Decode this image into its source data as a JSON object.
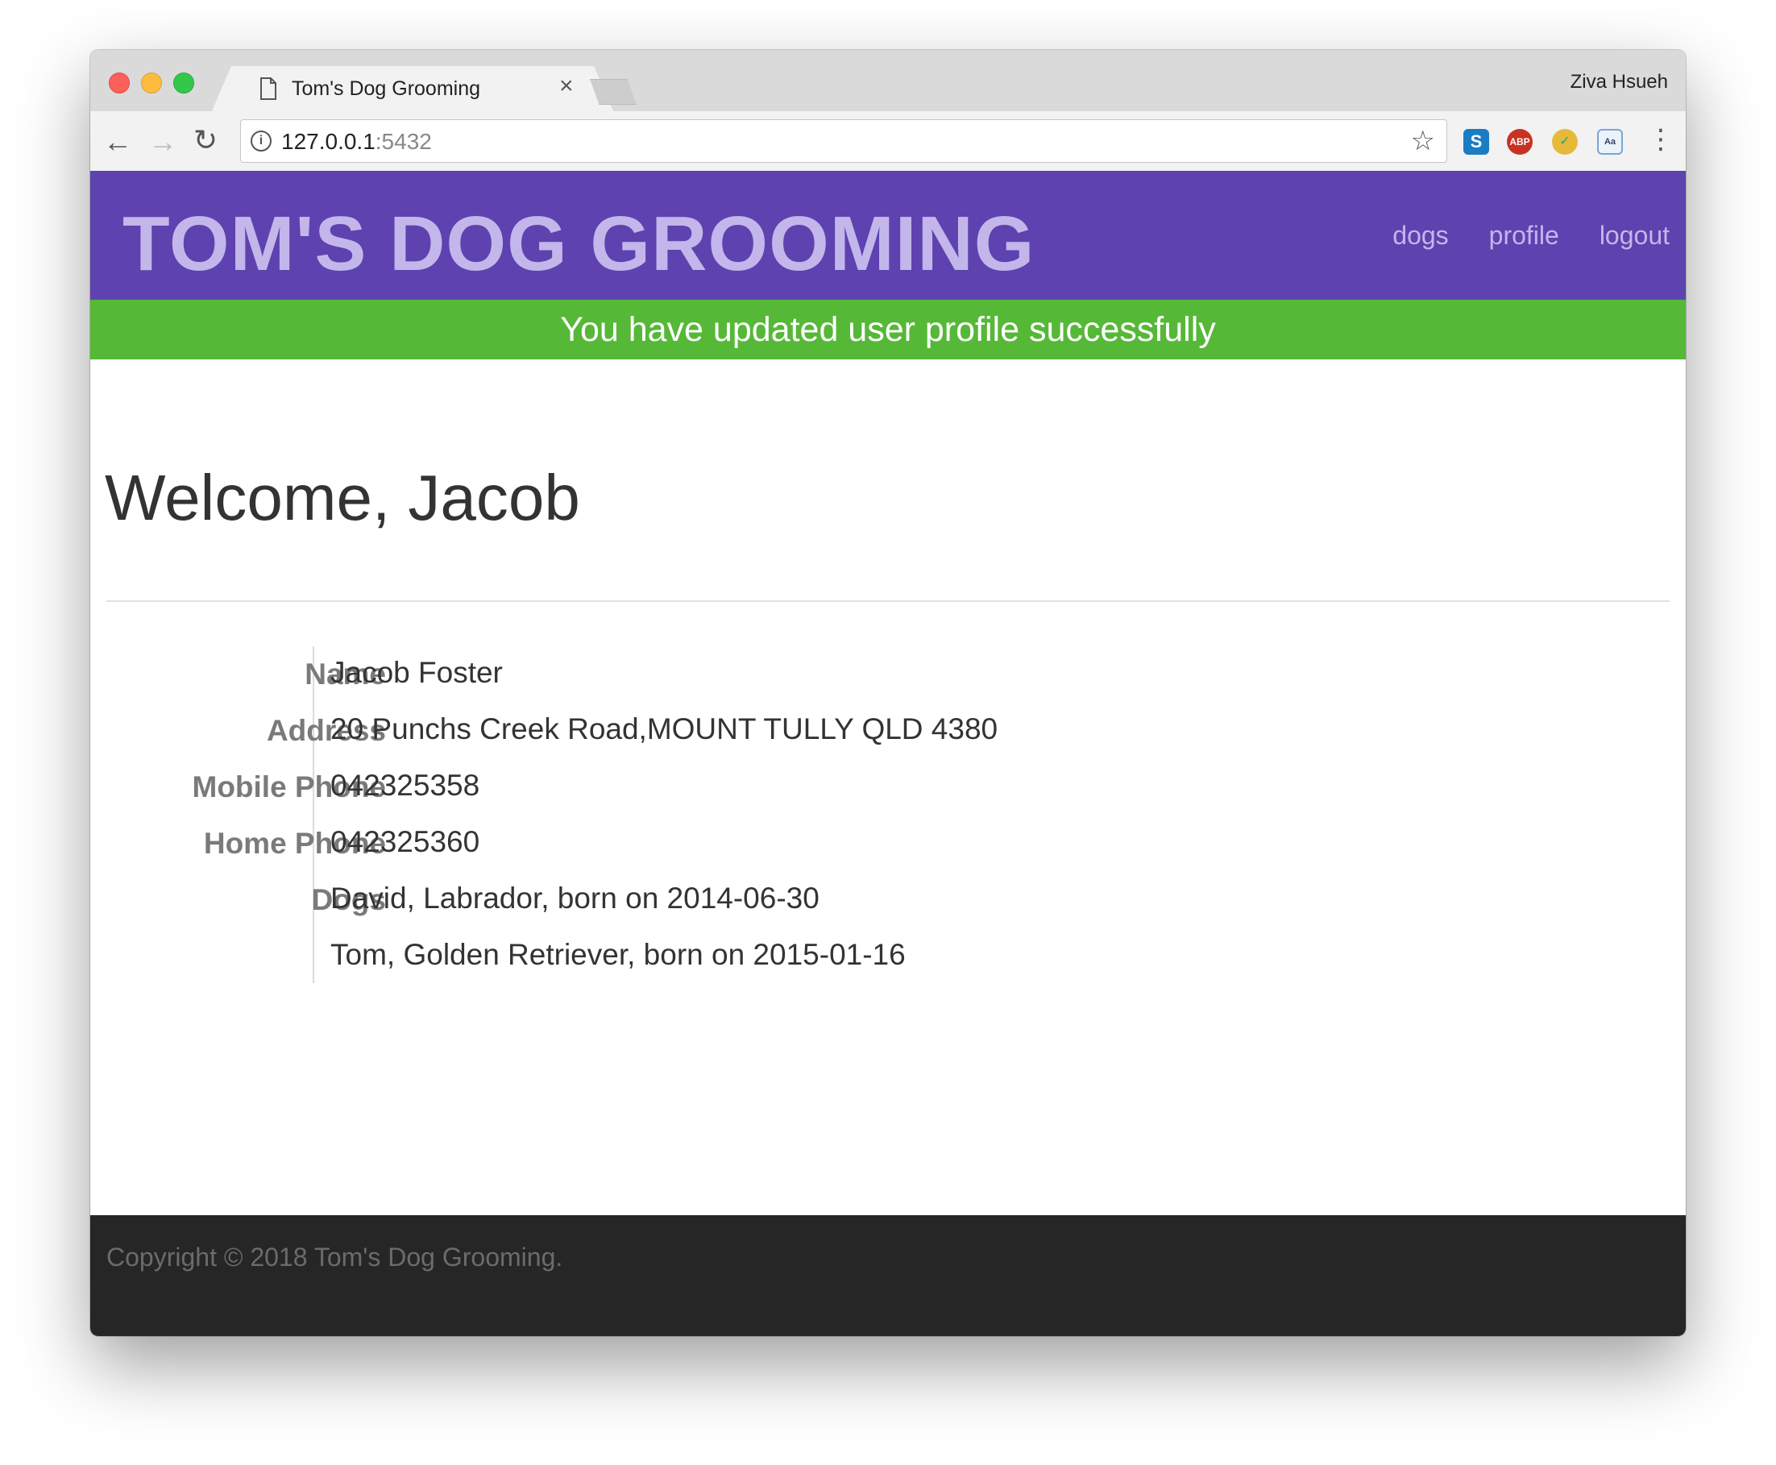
{
  "browser": {
    "tab_title": "Tom's Dog Grooming",
    "tab_close_glyph": "×",
    "profile_name": "Ziva Hsueh",
    "url_host": "127.0.0.1",
    "url_port": ":5432",
    "icons": [
      "back-icon",
      "forward-icon",
      "reload-icon",
      "info-icon",
      "star-icon",
      "skype-extension-icon",
      "adblock-extension-icon",
      "pen-extension-icon",
      "dictionary-extension-icon",
      "menu-icon"
    ]
  },
  "site": {
    "title": "TOM'S DOG GROOMING",
    "nav": [
      "dogs",
      "profile",
      "logout"
    ],
    "colors": {
      "header": "#5e42b0",
      "title": "#c3b6ea",
      "flash": "#56b837",
      "footer": "#262626"
    }
  },
  "flash_message": "You have updated user profile successfully",
  "welcome": "Welcome, Jacob",
  "profile": {
    "rows": [
      {
        "label": "Name",
        "value": "Jacob Foster"
      },
      {
        "label": "Address",
        "value": "20 Punchs Creek Road,MOUNT TULLY QLD 4380"
      },
      {
        "label": "Mobile Phone",
        "value": "042325358"
      },
      {
        "label": "Home Phone",
        "value": "042325360"
      },
      {
        "label": "Dogs",
        "value": "David, Labrador, born on 2014-06-30"
      },
      {
        "label": "",
        "value": "Tom, Golden Retriever, born on 2015-01-16"
      }
    ]
  },
  "footer": {
    "copyright": "Copyright © 2018 Tom's Dog Grooming."
  }
}
